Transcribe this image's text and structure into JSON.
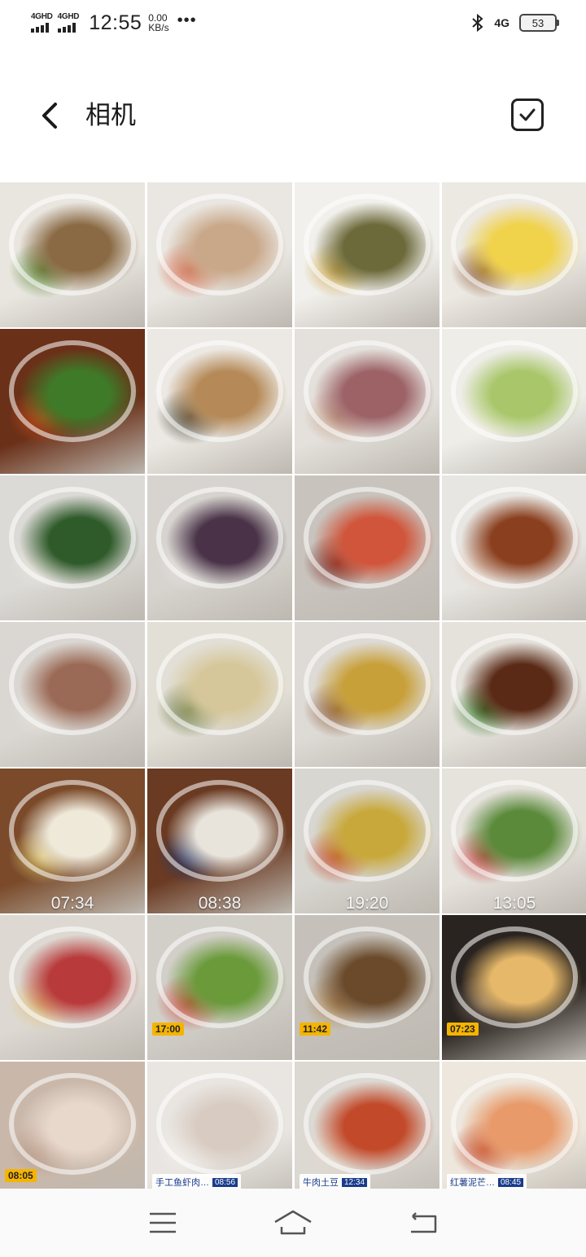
{
  "status_bar": {
    "net1": "4GHD",
    "net2": "4GHD",
    "time": "12:55",
    "speed_value": "0.00",
    "speed_unit": "KB/s",
    "more": "•••",
    "net3": "4G",
    "battery": "53"
  },
  "header": {
    "title": "相机"
  },
  "photos": [
    {
      "c1": "#e9e6e0",
      "c2": "#8a6a44",
      "c3": "#5e8a3a",
      "time": ""
    },
    {
      "c1": "#eae7e2",
      "c2": "#c9a88a",
      "c3": "#d56b4d",
      "time": ""
    },
    {
      "c1": "#f2f0ec",
      "c2": "#6c6a3a",
      "c3": "#caa64a",
      "time": ""
    },
    {
      "c1": "#ece8e2",
      "c2": "#f0d24b",
      "c3": "#8a5a34",
      "time": ""
    },
    {
      "c1": "#6a3018",
      "c2": "#3f7a28",
      "c3": "#c24a1a",
      "time": ""
    },
    {
      "c1": "#ece9e4",
      "c2": "#b58a58",
      "c3": "#4f4a3a",
      "time": ""
    },
    {
      "c1": "#e4e1dc",
      "c2": "#9c6266",
      "c3": "#c5a08a",
      "time": ""
    },
    {
      "c1": "#eeede8",
      "c2": "#a9c76a",
      "c3": "#f3efe5",
      "time": ""
    },
    {
      "c1": "#dcdad6",
      "c2": "#2f5a2a",
      "c3": "#e9e5dd",
      "time": ""
    },
    {
      "c1": "#d7d4cf",
      "c2": "#4a3348",
      "c3": "#e6e3de",
      "time": ""
    },
    {
      "c1": "#c8c3bd",
      "c2": "#d0553a",
      "c3": "#7a2a22",
      "time": ""
    },
    {
      "c1": "#e8e6e2",
      "c2": "#8a3f1e",
      "c3": "#e0c8b8",
      "time": ""
    },
    {
      "c1": "#dad7d2",
      "c2": "#9a6a56",
      "c3": "#e6e2dc",
      "time": ""
    },
    {
      "c1": "#e2dfd6",
      "c2": "#d6c79a",
      "c3": "#6a7a42",
      "time": ""
    },
    {
      "c1": "#dedbd6",
      "c2": "#c8a03a",
      "c3": "#8a5a3a",
      "time": ""
    },
    {
      "c1": "#e5e2dc",
      "c2": "#5a2a16",
      "c3": "#3b7a2e",
      "time": ""
    },
    {
      "c1": "#7a4a2a",
      "c2": "#efe9da",
      "c3": "#d8c06a",
      "time": "07:34"
    },
    {
      "c1": "#6a3a22",
      "c2": "#e8e4dc",
      "c3": "#2a3a6a",
      "time": "08:38"
    },
    {
      "c1": "#d8d6d0",
      "c2": "#c8a83a",
      "c3": "#c24a2a",
      "time": "19:20"
    },
    {
      "c1": "#e6e2dc",
      "c2": "#5a8a3a",
      "c3": "#c84a4a",
      "time": "13:05"
    },
    {
      "c1": "#ddd9d2",
      "c2": "#b83a3a",
      "c3": "#e0c07a",
      "time": ""
    },
    {
      "c1": "#d2cfc9",
      "c2": "#6a9a3a",
      "c3": "#c84a3a",
      "time": ""
    },
    {
      "c1": "#c5c1ba",
      "c2": "#6a4a2a",
      "c3": "#b08a5a",
      "time": ""
    },
    {
      "c1": "#2a2420",
      "c2": "#e6b86a",
      "c3": "#7a6a5a",
      "time": ""
    },
    {
      "c1": "#c9b8aa",
      "c2": "#e8d8cc",
      "c3": "#b89a88",
      "time": ""
    },
    {
      "c1": "#e9e6e2",
      "c2": "#d8ccc2",
      "c3": "#f2efeb",
      "time": ""
    },
    {
      "c1": "#dcd8d2",
      "c2": "#c24a2a",
      "c3": "#e6d8c8",
      "time": ""
    },
    {
      "c1": "#ede7dd",
      "c2": "#e89a6a",
      "c3": "#c24a2a",
      "time": ""
    }
  ],
  "stamps": {
    "s21": "17:00",
    "s22": "11:42",
    "s23": "07:23",
    "s24": "08:05"
  },
  "tags": {
    "t25": {
      "text": "手工鱼虾肉…",
      "time": "08:56"
    },
    "t26": {
      "text": "牛肉土豆",
      "time": "12:34"
    },
    "t27": {
      "text": "红薯泥芒…",
      "time": "08:45"
    }
  }
}
